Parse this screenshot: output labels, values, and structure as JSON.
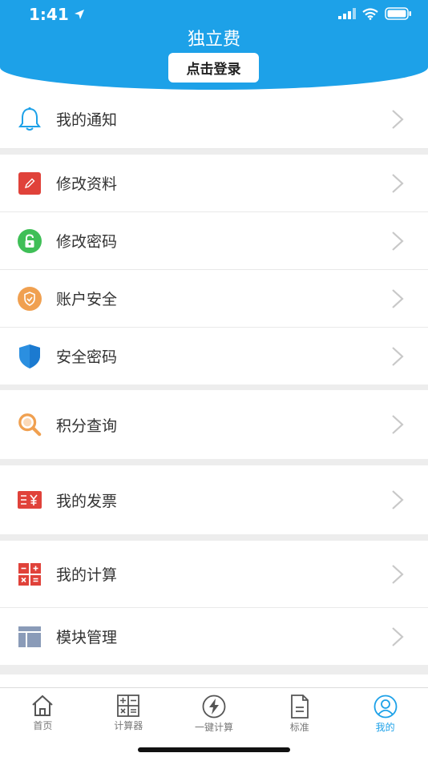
{
  "status_bar": {
    "time": "1:41"
  },
  "header": {
    "title": "独立费",
    "login_label": "点击登录"
  },
  "menu": {
    "notice": "我的通知",
    "edit_profile": "修改资料",
    "change_password": "修改密码",
    "account_security": "账户安全",
    "security_password": "安全密码",
    "points_query": "积分查询",
    "my_invoice": "我的发票",
    "my_calculation": "我的计算",
    "module_management": "模块管理"
  },
  "tabs": [
    {
      "label": "首页",
      "icon": "home-icon"
    },
    {
      "label": "计算器",
      "icon": "calculator-icon"
    },
    {
      "label": "一键计算",
      "icon": "lightning-icon"
    },
    {
      "label": "标准",
      "icon": "document-icon"
    },
    {
      "label": "我的",
      "icon": "user-icon",
      "active": true
    }
  ],
  "colors": {
    "brand": "#1da1e8",
    "red": "#e0423a",
    "green": "#3fbf57",
    "orange": "#f0a050"
  }
}
